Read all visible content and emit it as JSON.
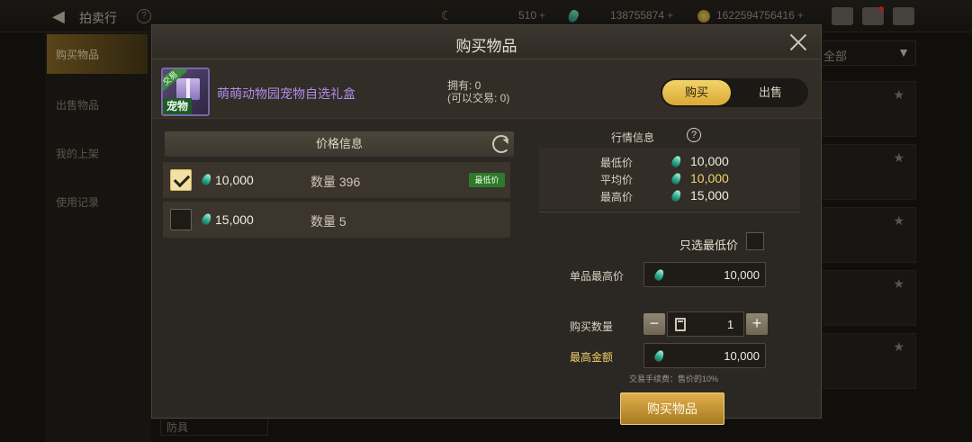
{
  "topbar": {
    "title": "拍卖行",
    "currency1": "510",
    "currency2": "138755874",
    "currency3": "1622594756416"
  },
  "sidebar": {
    "items": [
      "购买物品",
      "出售物品",
      "我的上架",
      "使用记录"
    ]
  },
  "right_filter": {
    "label": "全部"
  },
  "bottom_filter": {
    "label": "防具"
  },
  "modal": {
    "title": "购买物品",
    "item": {
      "name": "萌萌动物园宠物自选礼盒",
      "tag_trade": "交易",
      "tag_pet": "宠物",
      "owned_line1": "拥有: 0",
      "owned_line2": "(可以交易: 0)"
    },
    "mode_tabs": {
      "buy": "购买",
      "sell": "出售",
      "active": "buy"
    },
    "price_list": {
      "header": "价格信息",
      "rows": [
        {
          "price": "10,000",
          "qty_label": "数量 396",
          "checked": true,
          "badge": "最低价"
        },
        {
          "price": "15,000",
          "qty_label": "数量 5",
          "checked": false,
          "badge": ""
        }
      ]
    },
    "market": {
      "title": "行情信息",
      "help": "?",
      "min_label": "最低价",
      "min_value": "10,000",
      "avg_label": "平均价",
      "avg_value": "10,000",
      "max_label": "最高价",
      "max_value": "15,000"
    },
    "form": {
      "only_lowest_label": "只选最低价",
      "unit_max_label": "单品最高价",
      "unit_max_value": "10,000",
      "qty_label": "购买数量",
      "qty_value": "1",
      "minus": "−",
      "plus": "+",
      "total_label": "最高金额",
      "total_value": "10,000",
      "fee_note": "交易手续费：售价的10%",
      "submit": "购买物品"
    }
  },
  "colors": {
    "accent_gold": "#f3d36a",
    "item_name_purple": "#b08de8",
    "gem_teal": "#2ea58c",
    "badge_green": "#2f7a2a"
  }
}
